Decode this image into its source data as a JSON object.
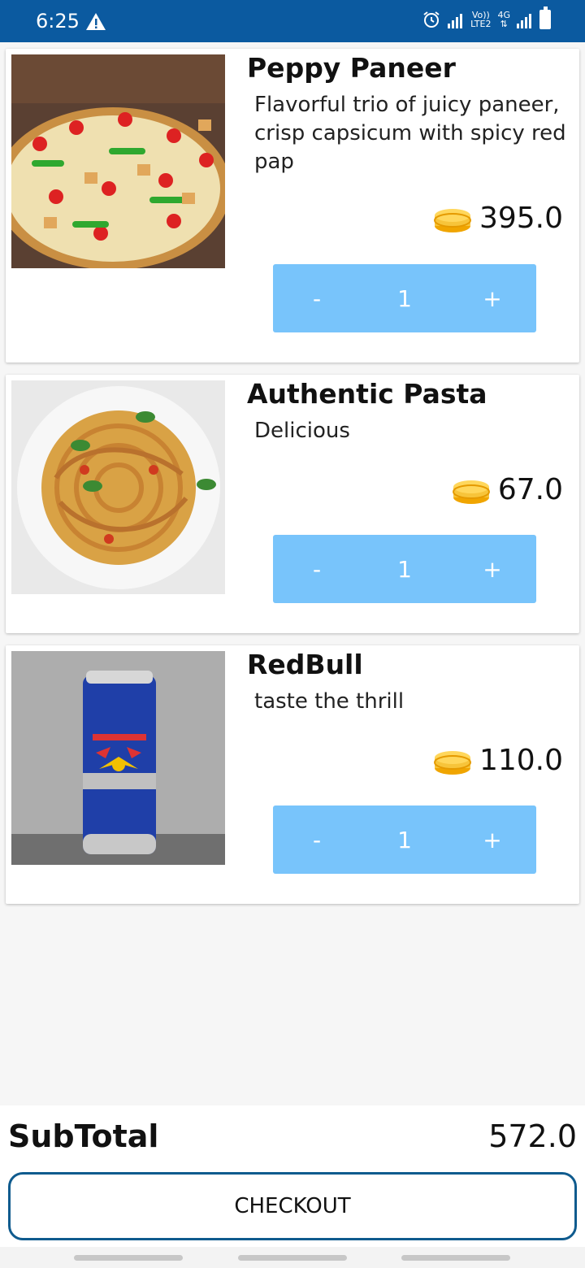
{
  "status": {
    "time": "6:25",
    "net1": "Vo))",
    "net2": "LTE2",
    "net3": "4G"
  },
  "cart": {
    "items": [
      {
        "title": "Peppy Paneer",
        "description": "Flavorful trio of juicy paneer, crisp capsicum with spicy red pap",
        "price": "395.0",
        "quantity": "1",
        "minus": "-",
        "plus": "+"
      },
      {
        "title": "Authentic Pasta",
        "description": "Delicious",
        "price": "67.0",
        "quantity": "1",
        "minus": "-",
        "plus": "+"
      },
      {
        "title": "RedBull",
        "description": "taste the thrill",
        "price": "110.0",
        "quantity": "1",
        "minus": "-",
        "plus": "+"
      }
    ]
  },
  "footer": {
    "subtotal_label": "SubTotal",
    "subtotal_value": "572.0",
    "checkout_label": "CHECKOUT"
  },
  "colors": {
    "status_bar": "#0b5aa0",
    "stepper": "#78c4fb",
    "checkout_border": "#0f5b8e"
  },
  "icons": {
    "warning": "warning-icon",
    "alarm": "alarm-icon",
    "coin": "coin-stack-icon"
  }
}
